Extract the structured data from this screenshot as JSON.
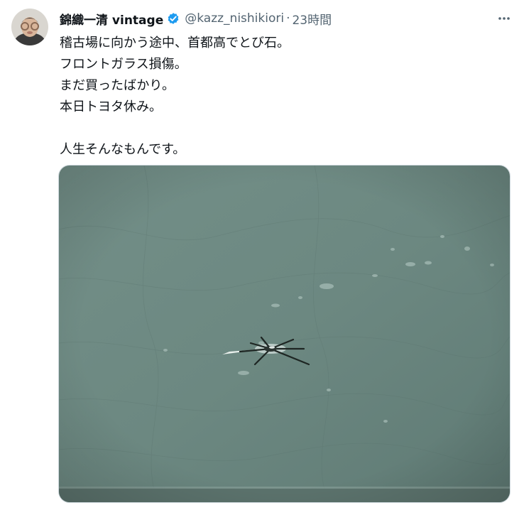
{
  "tweet": {
    "author": {
      "display_name": "錦織一清 vintage",
      "handle": "@kazz_nishikiori",
      "verified": true,
      "avatar_icon": "avatar-photo"
    },
    "separator": "·",
    "timestamp": "23時間",
    "more_icon": "more-horizontal-icon",
    "text_lines": [
      "稽古場に向かう途中、首都高でとび石。",
      "フロントガラス損傷。",
      "まだ買ったばかり。",
      "本日トヨタ休み。",
      "",
      "人生そんなもんです。"
    ],
    "media": {
      "type": "photo",
      "subject": "cracked windshield chip"
    }
  },
  "colors": {
    "text_primary": "#0f1419",
    "text_secondary": "#536471",
    "verified_blue": "#1d9bf0",
    "photo_glass": "#6f8a84"
  }
}
